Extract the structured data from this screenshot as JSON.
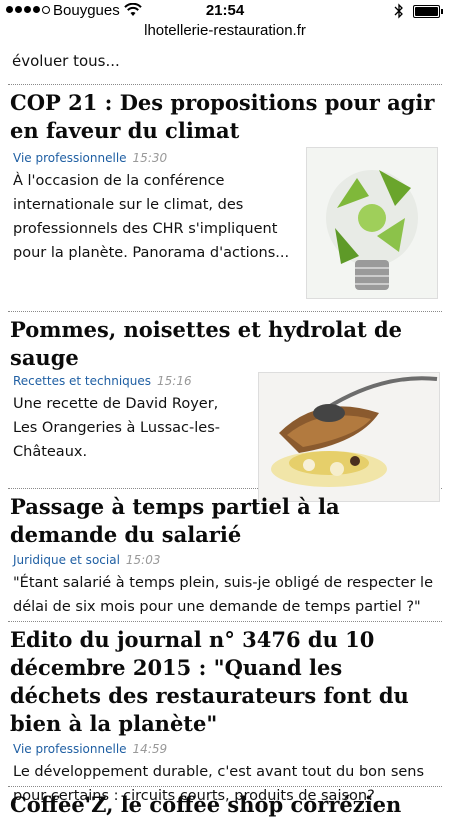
{
  "status_bar": {
    "carrier": "Bouygues",
    "time": "21:54"
  },
  "browser": {
    "url": "lhotellerie-restauration.fr"
  },
  "teaser_text": "évoluer tous...",
  "articles": [
    {
      "title": "COP 21 : Des propositions pour agir en faveur du climat",
      "category": "Vie professionnelle",
      "time": "15:30",
      "summary": "À l'occasion de la conférence internationale sur le climat, des professionnels des CHR s'impliquent pour la planète. Panorama d'actions..."
    },
    {
      "title": "Pommes, noisettes et hydrolat de sauge",
      "category": "Recettes et techniques",
      "time": "15:16",
      "summary": "Une recette de David Royer, Les Orangeries à Lussac-les-Châteaux."
    },
    {
      "title": "Passage à temps partiel à la demande du salarié",
      "category": "Juridique et social",
      "time": "15:03",
      "summary": "\"Étant salarié à temps plein, suis-je obligé de respecter le délai de six mois pour une demande de temps partiel ?\""
    },
    {
      "title": "Edito du journal n° 3476 du 10 décembre 2015 : \"Quand les déchets des restaurateurs font du bien à la planète\"",
      "category": "Vie professionnelle",
      "time": "14:59",
      "summary": "Le développement durable, c'est avant tout du bon sens pour certains : circuits courts, produits de saison?"
    },
    {
      "title": "Coffee'Z, le coffee shop corrézien"
    }
  ]
}
